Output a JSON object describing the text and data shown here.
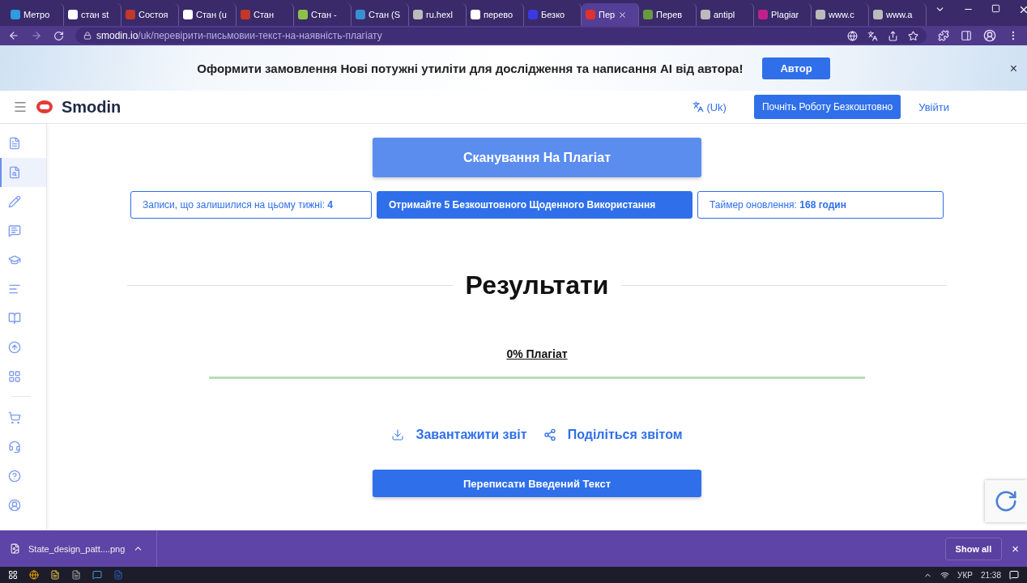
{
  "browser": {
    "tabs": [
      {
        "title": "Метро",
        "selected": false
      },
      {
        "title": "стан st",
        "selected": false
      },
      {
        "title": "Состоя",
        "selected": false
      },
      {
        "title": "Стан (u",
        "selected": false
      },
      {
        "title": "Стан",
        "selected": false
      },
      {
        "title": "Стан -",
        "selected": false
      },
      {
        "title": "Стан (S",
        "selected": false
      },
      {
        "title": "ru.hexl",
        "selected": false
      },
      {
        "title": "перево",
        "selected": false
      },
      {
        "title": "Безко",
        "selected": false
      },
      {
        "title": "Пер",
        "selected": true
      },
      {
        "title": "Перев",
        "selected": false
      },
      {
        "title": "antipl",
        "selected": false
      },
      {
        "title": "Plagiar",
        "selected": false
      },
      {
        "title": "www.c",
        "selected": false
      },
      {
        "title": "www.a",
        "selected": false
      }
    ],
    "address": {
      "host": "smodin.io",
      "path": "/uk/перевірити-письмовии-текст-на-наявність-плагіату"
    }
  },
  "banner": {
    "text": "Оформити замовлення Нові потужні утиліти для дослідження та написання AI від автора!",
    "button": "Автор",
    "close": "×"
  },
  "header": {
    "brand": "Smodin",
    "language": "(Uk)",
    "cta": "Почніть Роботу Безкоштовно",
    "login": "Увійти"
  },
  "sidebar": {
    "items": [
      {
        "kind": "doc",
        "selected": false
      },
      {
        "kind": "search",
        "selected": true
      },
      {
        "kind": "pencil",
        "selected": false
      },
      {
        "kind": "chat",
        "selected": false
      },
      {
        "kind": "grad",
        "selected": false
      },
      {
        "kind": "lines",
        "selected": false
      },
      {
        "kind": "book",
        "selected": false
      },
      {
        "kind": "letter",
        "selected": false
      },
      {
        "kind": "apps",
        "selected": false
      },
      {
        "kind": "cart",
        "selected": false
      },
      {
        "kind": "headset",
        "selected": false
      },
      {
        "kind": "help",
        "selected": false
      },
      {
        "kind": "user",
        "selected": false
      }
    ]
  },
  "main": {
    "scan_button": "Сканування На Плагіат",
    "stats": [
      {
        "kind": "outline",
        "text": "Записи, що залишилися на цьому тижні: **4**"
      },
      {
        "kind": "filled",
        "text": "Отримайте 5 Безкоштовного Щоденного Використання"
      },
      {
        "kind": "outline",
        "text": "Таймер оновлення: **168 годин**"
      }
    ],
    "results_title": "Результати",
    "plagiarism": "0% Плагіат",
    "plagiarism_meter": {
      "level": 1
    },
    "download": "Завантажити звіт",
    "share": "Поділіться звітом",
    "rewrite_button": "Переписати Введений Текст"
  },
  "download_bar": {
    "file": "State_design_patt....png",
    "show_all": "Show all",
    "close": "×"
  },
  "taskbar": {
    "language": "УКР",
    "time": "21:38"
  }
}
